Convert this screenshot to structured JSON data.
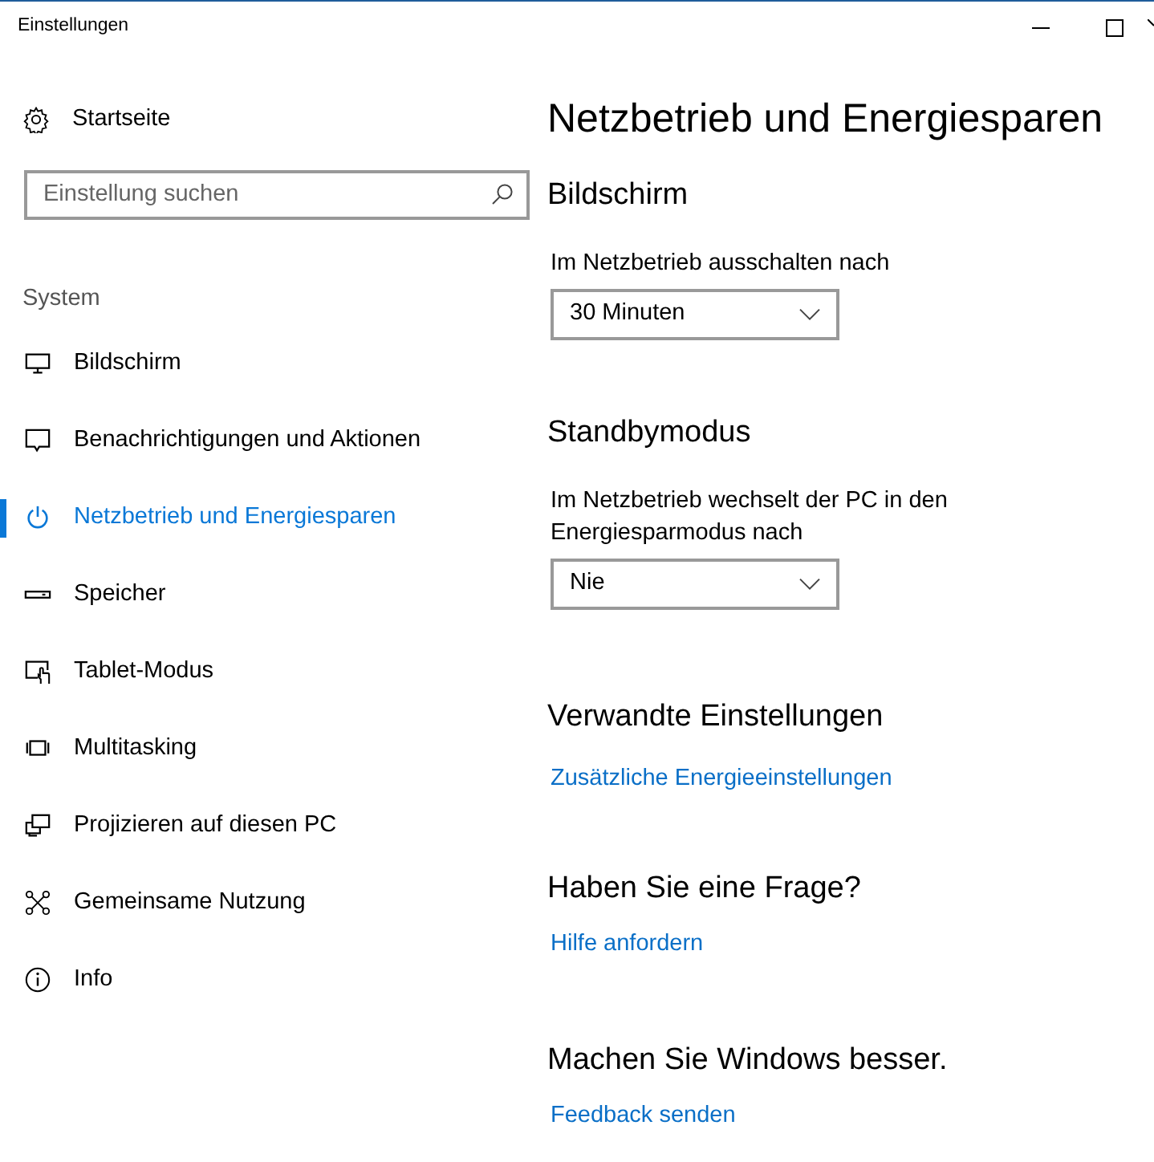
{
  "window": {
    "title": "Einstellungen"
  },
  "sidebar": {
    "home": "Startseite",
    "search": {
      "placeholder": "Einstellung suchen"
    },
    "group": "System",
    "items": [
      {
        "label": "Bildschirm",
        "selected": false
      },
      {
        "label": "Benachrichtigungen und Aktionen",
        "selected": false
      },
      {
        "label": "Netzbetrieb und Energiesparen",
        "selected": true
      },
      {
        "label": "Speicher",
        "selected": false
      },
      {
        "label": "Tablet-Modus",
        "selected": false
      },
      {
        "label": "Multitasking",
        "selected": false
      },
      {
        "label": "Projizieren auf diesen PC",
        "selected": false
      },
      {
        "label": "Gemeinsame Nutzung",
        "selected": false
      },
      {
        "label": "Info",
        "selected": false
      }
    ]
  },
  "content": {
    "title": "Netzbetrieb und Energiesparen",
    "sections": [
      {
        "heading": "Bildschirm",
        "kind": "dropdown",
        "label": "Im Netzbetrieb ausschalten nach",
        "value": "30 Minuten"
      },
      {
        "heading": "Standbymodus",
        "kind": "dropdown",
        "label": "Im Netzbetrieb wechselt der PC in den Energiesparmodus nach",
        "value": "Nie"
      },
      {
        "heading": "Verwandte Einstellungen",
        "kind": "link",
        "link": "Zusätzliche Energieeinstellungen"
      },
      {
        "heading": "Haben Sie eine Frage?",
        "kind": "link",
        "link": "Hilfe anfordern"
      },
      {
        "heading": "Machen Sie Windows besser.",
        "kind": "link",
        "link": "Feedback senden"
      }
    ]
  }
}
